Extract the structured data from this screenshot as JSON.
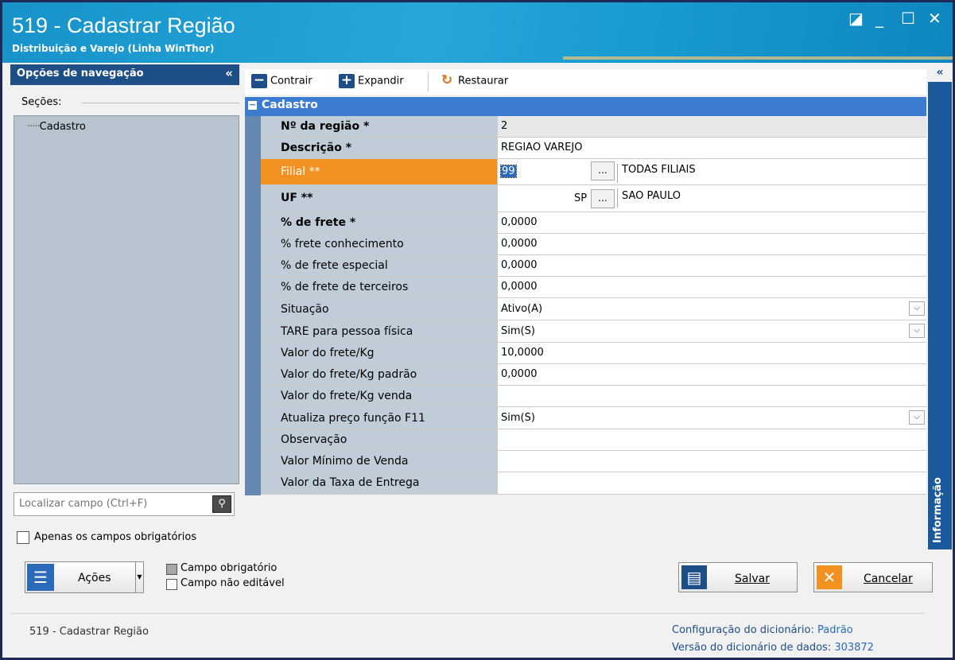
{
  "window": {
    "title": "519 - Cadastrar Região",
    "subtitle": "Distribuição e Varejo (Linha WinThor)",
    "controls": {
      "restore": "◪",
      "minimize": "_",
      "maximize": "☐",
      "close": "✕"
    }
  },
  "nav": {
    "header": "Opções de navegação",
    "collapse": "«",
    "sections_label": "Seções:",
    "tree_prefix": "·····",
    "tree_item": "Cadastro",
    "search_placeholder": "Localizar campo (Ctrl+F)",
    "search_icon": "magnifier-icon",
    "only_required": "Apenas os campos obrigatórios"
  },
  "toolbar": {
    "collapse_label": "Contrair",
    "expand_label": "Expandir",
    "restore_label": "Restaurar"
  },
  "side": {
    "collapse": "«",
    "info_tab": "Informação"
  },
  "category": "Cadastro",
  "fields": {
    "regiao": {
      "label": "Nº da região *",
      "value": "2"
    },
    "descricao": {
      "label": "Descrição *",
      "value": "REGIAO VAREJO"
    },
    "filial": {
      "label": "Filial **",
      "value": "99",
      "ellipsis": "...",
      "desc": "TODAS FILIAIS"
    },
    "uf": {
      "label": "UF **",
      "value": "SP",
      "ellipsis": "...",
      "desc": "SAO PAULO"
    },
    "frete": {
      "label": "% de frete *",
      "value": "0,0000"
    },
    "frete_conhecimento": {
      "label": "% frete conhecimento",
      "value": "0,0000"
    },
    "frete_especial": {
      "label": "% de frete especial",
      "value": "0,0000"
    },
    "frete_terceiros": {
      "label": "% de frete de terceiros",
      "value": "0,0000"
    },
    "situacao": {
      "label": "Situação",
      "value": "Ativo(A)"
    },
    "tare": {
      "label": "TARE para pessoa física",
      "value": "Sim(S)"
    },
    "valor_frete_kg": {
      "label": "Valor do frete/Kg",
      "value": "10,0000"
    },
    "valor_frete_kg_padrao": {
      "label": "Valor do frete/Kg padrão",
      "value": "0,0000"
    },
    "valor_frete_kg_venda": {
      "label": "Valor do frete/Kg venda",
      "value": ""
    },
    "atualiza_preco": {
      "label": "Atualiza preço função F11",
      "value": "Sim(S)"
    },
    "observacao": {
      "label": "Observação",
      "value": ""
    },
    "valor_minimo": {
      "label": "Valor Mínimo de Venda",
      "value": ""
    },
    "taxa_entrega": {
      "label": "Valor da Taxa de Entrega",
      "value": ""
    }
  },
  "dropdown_glyph": "⌵",
  "bottom": {
    "actions_label": "Ações",
    "legend_required": "Campo obrigatório",
    "legend_noneditable": "Campo não editável",
    "save_label": "Salvar",
    "cancel_label": "Cancelar"
  },
  "status": {
    "left": "519 - Cadastrar Região",
    "dict_config_label": "Configuração do dicionário:",
    "dict_config_value": "Padrão",
    "dict_version_label": "Versão do dicionário de dados:",
    "dict_version_value": "303872"
  },
  "colors": {
    "titlebar": "#1793c9",
    "nav_header": "#1e4e86",
    "category_bar": "#3b7bd0",
    "active_field": "#f29020",
    "label_cell": "#c0cdd8"
  }
}
